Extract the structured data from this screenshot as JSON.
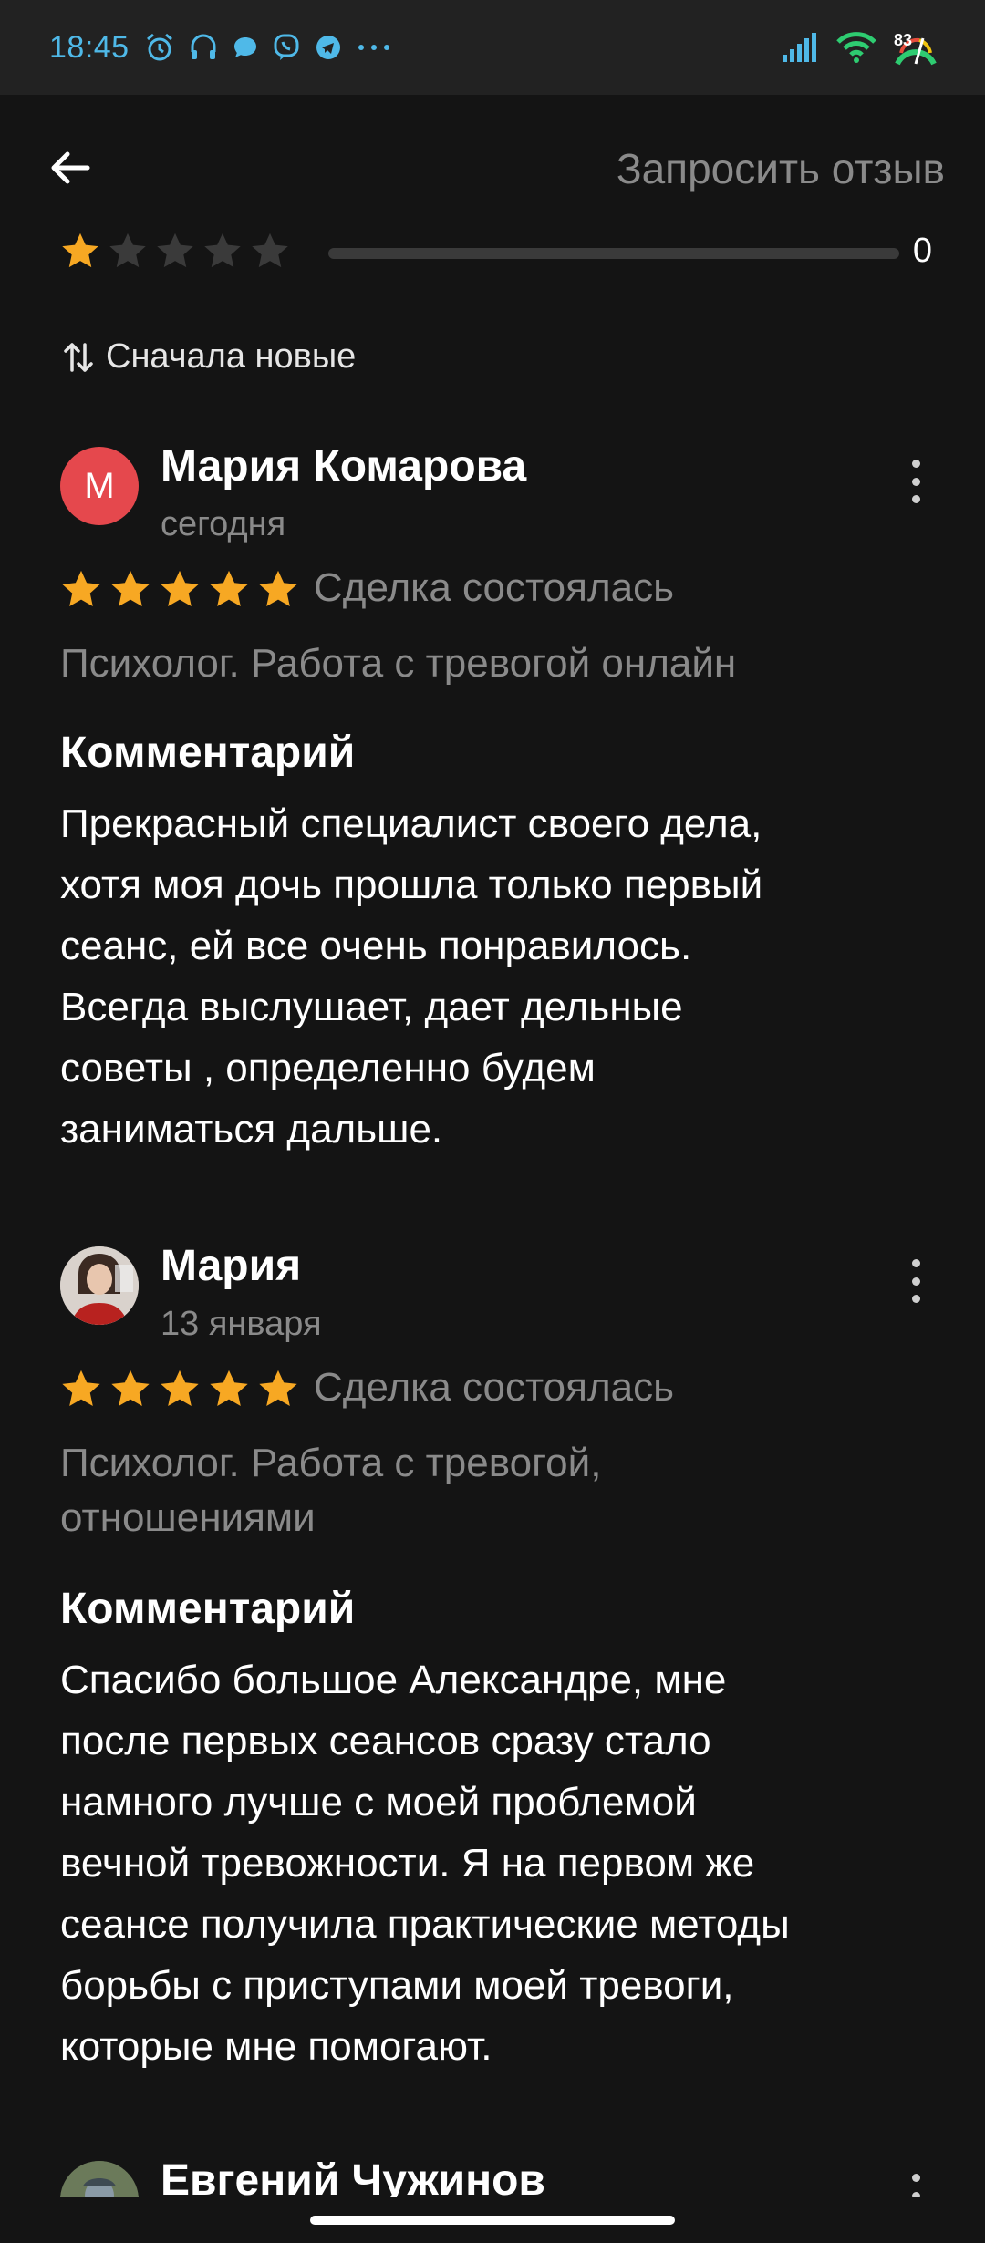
{
  "status_bar": {
    "time": "18:45",
    "battery_percent": "83",
    "icons": [
      "alarm-icon",
      "headset-icon",
      "chat-bubble-icon",
      "viber-icon",
      "telegram-icon",
      "more-dots-icon"
    ],
    "right_icons": [
      "signal-icon",
      "wifi-icon",
      "battery-icon"
    ]
  },
  "app_bar": {
    "back_icon": "arrow-left-icon",
    "request_review_label": "Запросить отзыв"
  },
  "rating_summary": {
    "stars": 1,
    "count": "0",
    "bar_fill_fraction": 0
  },
  "sort": {
    "icon": "sort-arrows-icon",
    "label": "Сначала новые"
  },
  "reviews": [
    {
      "avatar_letter": "М",
      "avatar_color": "#e5484d",
      "author": "Мария Комарова",
      "date": "сегодня",
      "rating": 5,
      "deal_status": "Сделка состоялась",
      "service": "Психолог. Работа с тревогой онлайн",
      "comment_title": "Комментарий",
      "comment_lines": [
        "Прекрасный специалист своего дела,",
        "хотя моя дочь прошла только первый",
        "сеанс, ей все очень понравилось.",
        "Всегда выслушает, дает дельные",
        "советы , определенно будем",
        "заниматься дальше."
      ]
    },
    {
      "avatar_letter": "",
      "author": "Мария",
      "date": "13 января",
      "rating": 5,
      "deal_status": "Сделка состоялась",
      "service_lines": [
        "Психолог. Работа с тревогой,",
        "отношениями"
      ],
      "comment_title": "Комментарий",
      "comment_lines": [
        "Спасибо большое Александре, мне",
        "после первых сеансов сразу стало",
        "намного лучше с моей проблемой",
        "вечной тревожности. Я на первом же",
        "сеансе получила практические методы",
        "борьбы с приступами моей тревоги,",
        "которые мне помогают."
      ]
    },
    {
      "author": "Евгений Чужинов"
    }
  ],
  "colors": {
    "star_filled": "#f7a823",
    "star_empty": "#3a3a3a",
    "accent_time": "#4fb9e8"
  }
}
